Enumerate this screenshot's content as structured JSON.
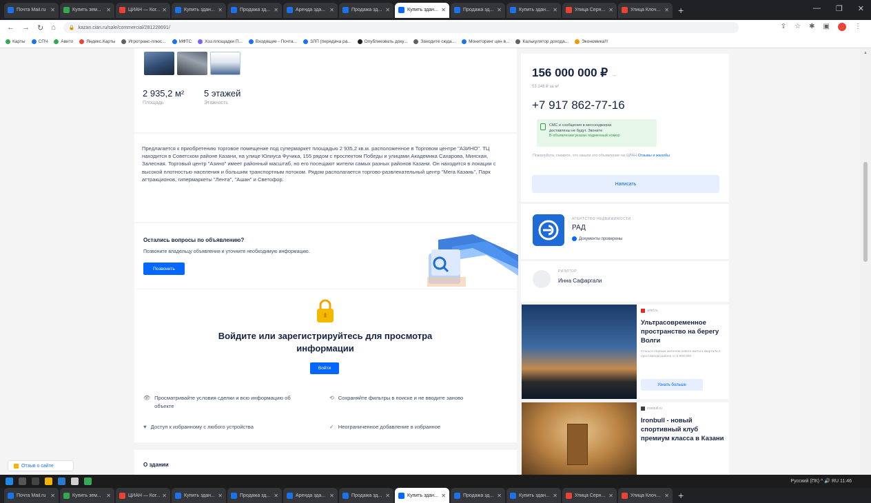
{
  "browser": {
    "tabs": [
      {
        "label": "Почта Mail.ru",
        "color": "#1a73e8",
        "active": false
      },
      {
        "label": "Купить зем...",
        "color": "#34a853",
        "active": false
      },
      {
        "label": "ЦИАН — Ког...",
        "color": "#ea4335",
        "active": false
      },
      {
        "label": "Купить здан...",
        "color": "#1a73e8",
        "active": false
      },
      {
        "label": "Продажа зд...",
        "color": "#1a73e8",
        "active": false
      },
      {
        "label": "Аренда зда...",
        "color": "#1a73e8",
        "active": false
      },
      {
        "label": "Продажа зд...",
        "color": "#1a73e8",
        "active": false
      },
      {
        "label": "Купить здан...",
        "color": "#0468ff",
        "active": true
      },
      {
        "label": "Продажа зд...",
        "color": "#1a73e8",
        "active": false
      },
      {
        "label": "Купить здан...",
        "color": "#1a73e8",
        "active": false
      },
      {
        "label": "Улица Серн...",
        "color": "#ea4335",
        "active": false
      },
      {
        "label": "Улица Клоч...",
        "color": "#ea4335",
        "active": false
      }
    ],
    "url": "kazan.cian.ru/sale/commercial/281228691/",
    "bookmarks": [
      "Карты",
      "СПЧ",
      "Авито",
      "Яндекс.Карты",
      "Игротранс-плюс...",
      "МФТС",
      "Хоз.площадки П...",
      "Входящие - Почта...",
      "ЗЛП (передача ра...",
      "Опубликовать доку...",
      "Заходите сюда...",
      "Мониторинг цен в...",
      "Калькулятор дохода...",
      "Экономика!!!"
    ]
  },
  "listing": {
    "area_value": "2 935,2 м²",
    "area_label": "Площадь",
    "floors_value": "5 этажей",
    "floors_label": "Этажность",
    "description": "Предлагается к приобретению торговое помещение под супермаркет площадью 2 935,2 кв.м. расположенное в Торговом центре \"АЗИНО\". ТЦ находится в Советском районе Казани, на улице Юлиуса Фучика, 155 рядом с проспектом Победы и улицами Академика Сахарова, Минская, Залесная. Торговый центр \"Азино\" имеет районный масштаб, но его посещают жители самых разных районов Казани. Он находится в локации с высокой плотностью населения и большим транспортным потоком. Рядом располагается торгово-развлекательный центр \"Мега Казань\", Парк аттракционов, гипермаркеты \"Лента\", \"Ашан\" и Светофор.",
    "questions_title": "Остались вопросы по объявлению?",
    "questions_sub": "Позвоните владельцу объявления и уточните необходимую информацию.",
    "call_button": "Позвонить",
    "auth_title": "Войдите или зарегистрируйтесь для просмотра информации",
    "login_button": "Войти",
    "features": [
      "Просматривайте условия сделки и всю информацию об объекте",
      "Сохраняйте фильтры в поиске и не вводите заново",
      "Доступ к избранному с любого устройства",
      "Неограниченное добавление в избранное"
    ],
    "about_title": "О здании",
    "feedback": "Отзыв о сайте"
  },
  "sidebar": {
    "price": "156 000 000 ₽",
    "price_per_m": "53 148 ₽ за м²",
    "phone": "+7 917 862-77-16",
    "sms_line1": "СМС и сообщения в мессенджерах",
    "sms_line2": "доставлены не будут. Звоните",
    "sms_line3": "В объявлении указан подменный номер",
    "notice": "Пожалуйста, скажите, что нашли это объявление на ЦИАН",
    "notice_link": "Отзывы и жалобы",
    "write_button": "Написать",
    "agency_label": "АГЕНТСТВО НЕДВИЖИМОСТИ",
    "agency_name": "РАД",
    "agency_verified": "Документы проверены",
    "realtor_label": "РИЭЛТОР",
    "realtor_name": "Инна Сафаргали",
    "ad1": {
      "source": "artel.ru",
      "title": "Ультрасовременное пространство на берегу Волги",
      "small": "Станьте первым жителем нового жилого квартала в престижном районе от 5 900 000",
      "button": "Узнать больше"
    },
    "ad2": {
      "source": "ironbull.ru",
      "title": "Ironbull - новый спортивный клуб премиум класса в Казани"
    }
  },
  "taskbar": {
    "clock": "Русский (ПК) ^ 🔊 RU 11:46"
  }
}
